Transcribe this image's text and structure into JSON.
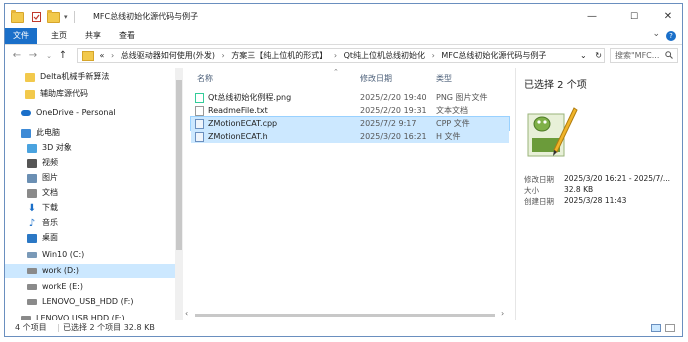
{
  "window": {
    "title": "MFC总线初始化源代码与例子",
    "minimize": "—",
    "maximize": "☐",
    "close": "✕"
  },
  "ribbon": {
    "tabs": [
      "文件",
      "主页",
      "共享",
      "查看"
    ],
    "help": "?"
  },
  "address": {
    "overflow": "«",
    "path": [
      "总线驱动器如何使用(外发)",
      "方案三【纯上位机的形式】",
      "Qt纯上位机总线初始化",
      "MFC总线初始化源代码与例子"
    ],
    "search_placeholder": "搜索\"MFC..."
  },
  "nav": {
    "items": [
      {
        "label": "Delta机械手新算法",
        "icon": "folder-icon",
        "color": "#f2c94c"
      },
      {
        "label": "辅助库源代码",
        "icon": "folder-icon",
        "color": "#f2c94c"
      },
      {
        "label": "OneDrive - Personal",
        "icon": "onedrive-icon",
        "color": "#1a6fc9"
      },
      {
        "label": "此电脑",
        "icon": "computer-icon",
        "color": "#3d8ad6"
      },
      {
        "label": "3D 对象",
        "icon": "3d-objects-icon",
        "color": "#4aa3df"
      },
      {
        "label": "视频",
        "icon": "video-icon",
        "color": "#555"
      },
      {
        "label": "图片",
        "icon": "pictures-icon",
        "color": "#6b8fb3"
      },
      {
        "label": "文档",
        "icon": "documents-icon",
        "color": "#8a8a8a"
      },
      {
        "label": "下载",
        "icon": "downloads-icon",
        "color": "#1a6fc9"
      },
      {
        "label": "音乐",
        "icon": "music-icon",
        "color": "#1a6fc9"
      },
      {
        "label": "桌面",
        "icon": "desktop-icon",
        "color": "#2b78c5"
      },
      {
        "label": "Win10 (C:)",
        "icon": "drive-icon",
        "color": "#7a9ab8"
      },
      {
        "label": "work (D:)",
        "icon": "drive-icon",
        "color": "#8a8a8a"
      },
      {
        "label": "workE (E:)",
        "icon": "drive-icon",
        "color": "#8a8a8a"
      },
      {
        "label": "LENOVO_USB_HDD (F:)",
        "icon": "drive-icon",
        "color": "#8a8a8a"
      },
      {
        "label": "LENOVO USB HDD (F:)",
        "icon": "drive-icon",
        "color": "#8a8a8a"
      }
    ],
    "selected_index": 12
  },
  "files": {
    "columns": [
      "名称",
      "修改日期",
      "类型"
    ],
    "rows": [
      {
        "name": "Qt总线初始化例程.png",
        "date": "2025/2/20 19:40",
        "type": "PNG 图片文件",
        "icon": "png-file-icon",
        "selected": false
      },
      {
        "name": "ReadmeFile.txt",
        "date": "2025/2/20 19:31",
        "type": "文本文档",
        "icon": "txt-file-icon",
        "selected": false
      },
      {
        "name": "ZMotionECAT.cpp",
        "date": "2025/7/2 9:17",
        "type": "CPP 文件",
        "icon": "cpp-file-icon",
        "selected": true
      },
      {
        "name": "ZMotionECAT.h",
        "date": "2025/3/20 16:21",
        "type": "H 文件",
        "icon": "h-file-icon",
        "selected": true
      }
    ]
  },
  "details": {
    "title": "已选择 2 个项",
    "props": [
      {
        "label": "修改日期",
        "value": "2025/3/20 16:21 - 2025/7/..."
      },
      {
        "label": "大小",
        "value": "32.8 KB"
      },
      {
        "label": "创建日期",
        "value": "2025/3/28 11:43"
      }
    ]
  },
  "status": {
    "count": "4 个项目",
    "selection": "已选择 2 个项目  32.8 KB"
  }
}
